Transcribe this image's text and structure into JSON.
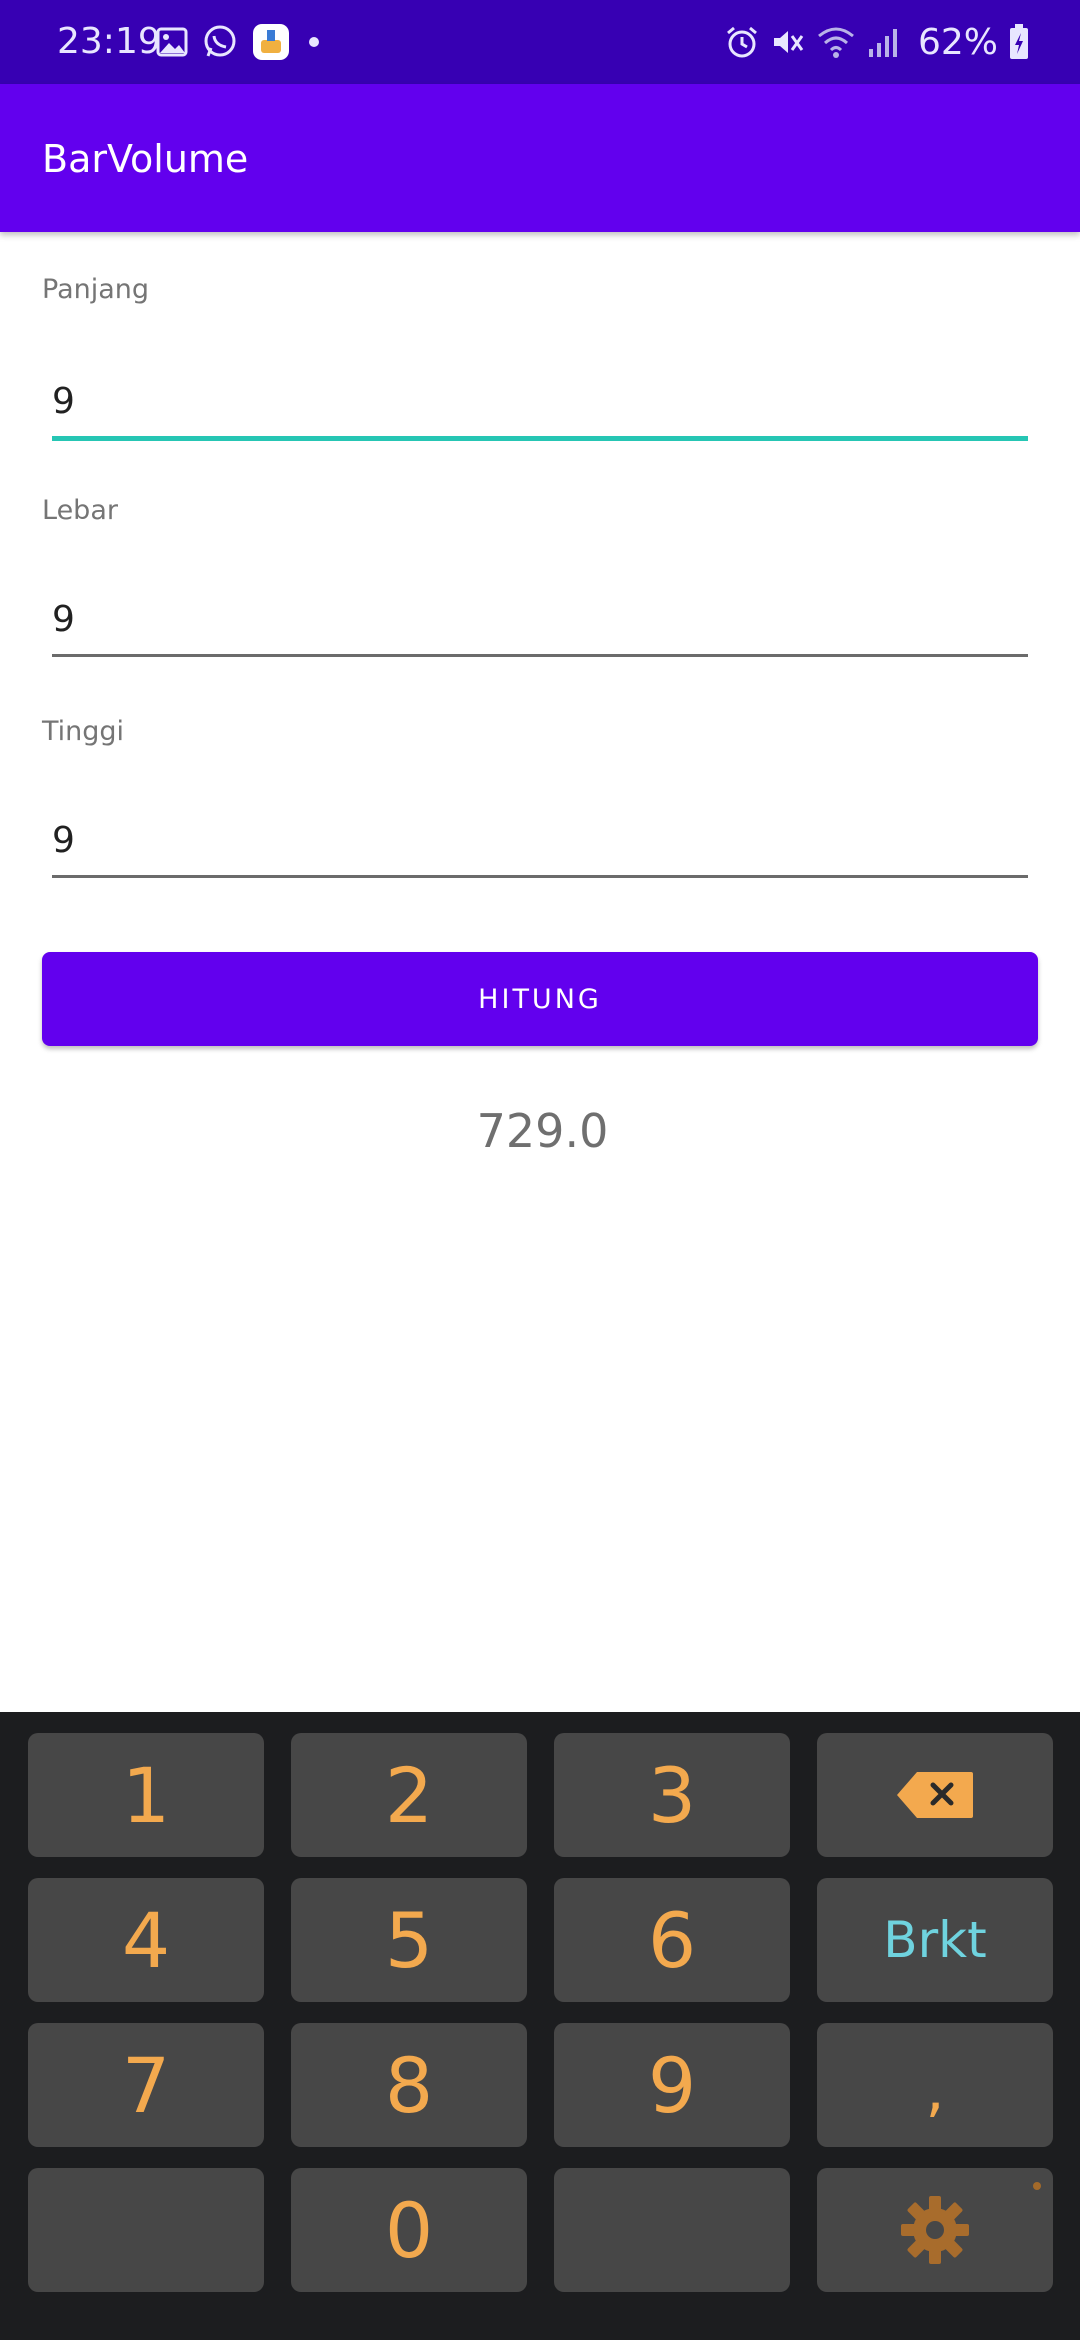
{
  "status_bar": {
    "time": "23:19",
    "left_icons": [
      "image-icon",
      "whatsapp-icon",
      "cleaner-app-icon",
      "notification-dot-icon"
    ],
    "right_icons": [
      "alarm-icon",
      "vibrate-mute-icon",
      "wifi-icon",
      "signal-icon",
      "battery-charging-icon"
    ],
    "battery_percent": "62%"
  },
  "app_bar": {
    "title": "BarVolume"
  },
  "form": {
    "fields": [
      {
        "label": "Panjang",
        "value": "9",
        "focused": true
      },
      {
        "label": "Lebar",
        "value": "9",
        "focused": false
      },
      {
        "label": "Tinggi",
        "value": "9",
        "focused": false
      }
    ],
    "button_label": "HITUNG",
    "result": "729.0"
  },
  "keyboard": {
    "rows": [
      [
        "1",
        "2",
        "3",
        "backspace"
      ],
      [
        "4",
        "5",
        "6",
        "Brkt"
      ],
      [
        "7",
        "8",
        "9",
        ","
      ],
      [
        "",
        "0",
        "",
        "settings"
      ]
    ],
    "digit_color": "#f3a94e",
    "brkt_color": "#6fd3df",
    "backspace_icon": "backspace-icon",
    "settings_icon": "gear-icon"
  },
  "colors": {
    "status_bar": "#3700b3",
    "primary": "#6200ee",
    "focus_underline": "#26c6b4",
    "keyboard_bg": "#1c1d1f",
    "key_bg": "#474747"
  }
}
